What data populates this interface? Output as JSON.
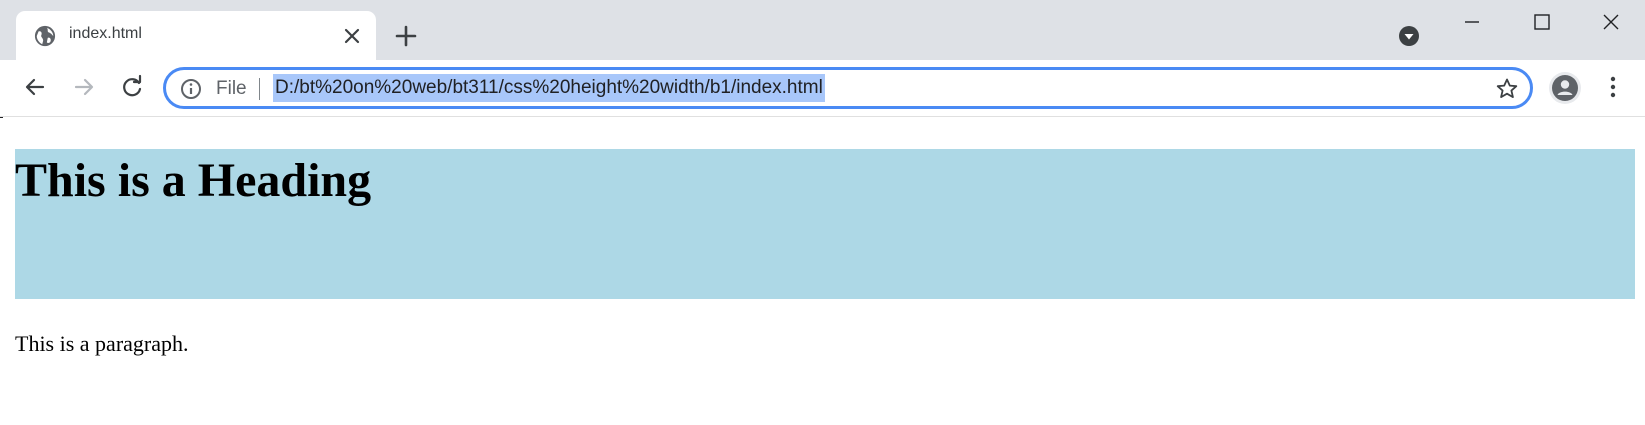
{
  "tab": {
    "title": "index.html",
    "favicon": "globe-icon"
  },
  "toolbar": {
    "back": "back-arrow-icon",
    "forward": "forward-arrow-icon",
    "reload": "reload-icon"
  },
  "omnibox": {
    "scheme_label": "File",
    "url": "D:/bt%20on%20web/bt311/css%20height%20width/b1/index.html",
    "selection_color": "#a8c7fa",
    "focus_color": "#4a8af4"
  },
  "page": {
    "heading": "This is a Heading",
    "heading_background": "#add8e6",
    "paragraph": "This is a paragraph."
  }
}
